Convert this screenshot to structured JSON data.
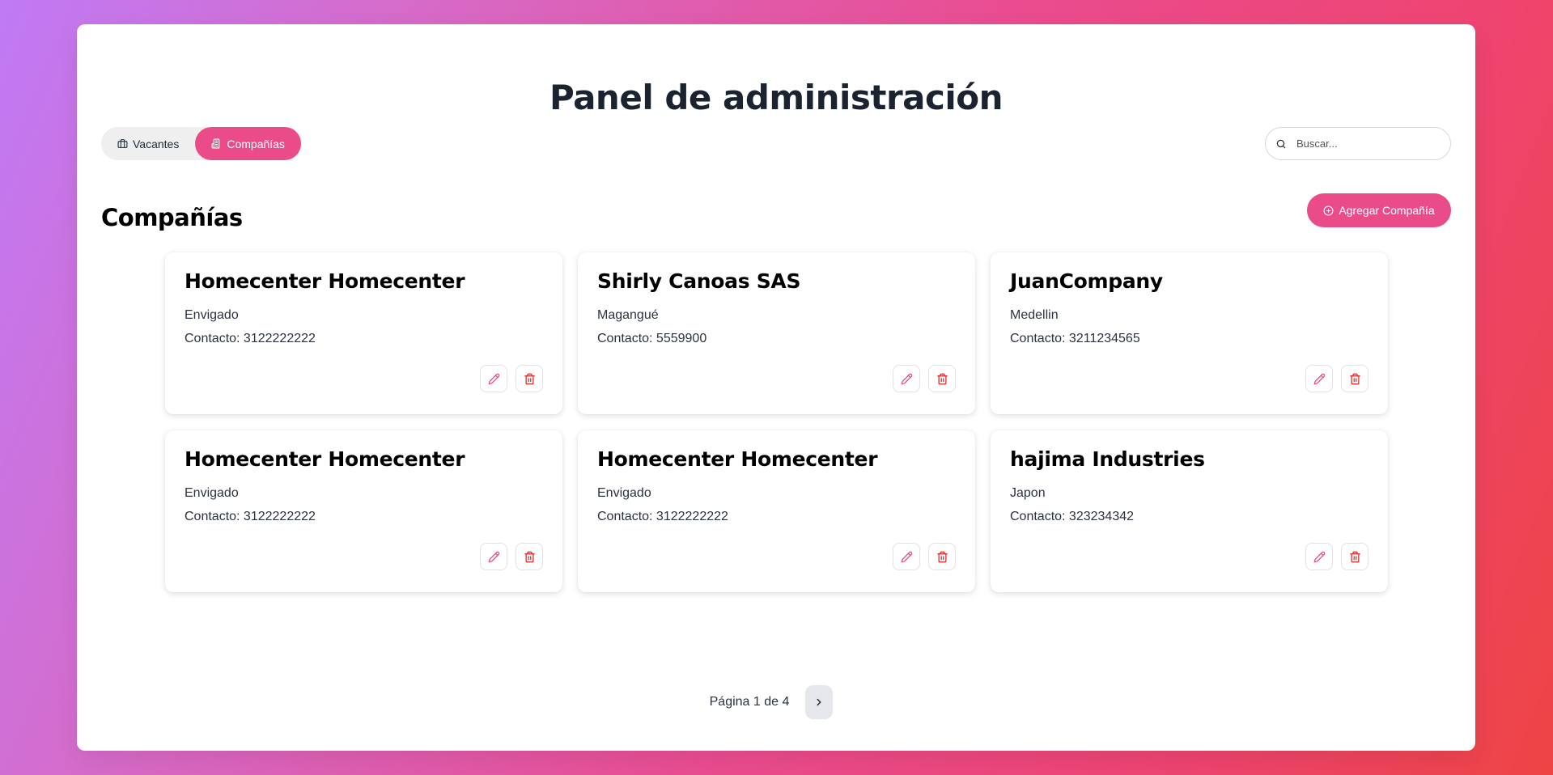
{
  "header": {
    "title": "Panel de administración"
  },
  "tabs": [
    {
      "label": "Vacantes",
      "icon": "briefcase-icon",
      "active": false
    },
    {
      "label": "Compañías",
      "icon": "building-icon",
      "active": true
    }
  ],
  "search": {
    "placeholder": "Buscar...",
    "value": ""
  },
  "section": {
    "title": "Compañías",
    "add_button": "Agregar Compañía"
  },
  "companies": [
    {
      "name": "Homecenter Homecenter",
      "city": "Envigado",
      "contact": "Contacto: 3122222222"
    },
    {
      "name": "Shirly Canoas SAS",
      "city": "Magangué",
      "contact": "Contacto: 5559900"
    },
    {
      "name": "JuanCompany",
      "city": "Medellin",
      "contact": "Contacto: 3211234565"
    },
    {
      "name": "Homecenter Homecenter",
      "city": "Envigado",
      "contact": "Contacto: 3122222222"
    },
    {
      "name": "Homecenter Homecenter",
      "city": "Envigado",
      "contact": "Contacto: 3122222222"
    },
    {
      "name": "hajima Industries",
      "city": "Japon",
      "contact": "Contacto: 323234342"
    }
  ],
  "pagination": {
    "text": "Página 1 de 4"
  },
  "colors": {
    "accent": "#ea4c89",
    "danger": "#dc2626",
    "text": "#1b2331"
  }
}
